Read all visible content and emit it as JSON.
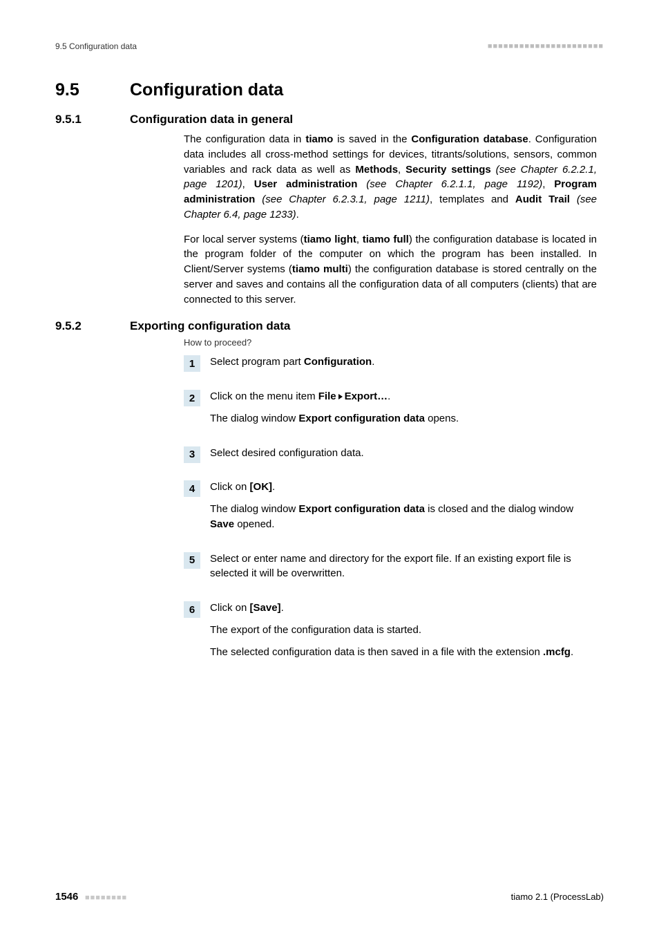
{
  "header": {
    "left": "9.5 Configuration data",
    "right_decor": "■■■■■■■■■■■■■■■■■■■■■■"
  },
  "section": {
    "number": "9.5",
    "title": "Configuration data"
  },
  "sub1": {
    "number": "9.5.1",
    "title": "Configuration data in general",
    "p1_a": "The configuration data in ",
    "p1_b": "tiamo",
    "p1_c": " is saved in the ",
    "p1_d": "Configuration database",
    "p1_e": ". Configuration data includes all cross-method settings for devices, titrants/solutions, sensors, common variables and rack data as well as ",
    "p1_f": "Methods",
    "p1_g": ", ",
    "p1_h": "Security settings",
    "p1_i": " (see Chapter 6.2.2.1, page 1201)",
    "p1_j": ", ",
    "p1_k": "User administration",
    "p1_l": " (see Chapter 6.2.1.1, page 1192)",
    "p1_m": ", ",
    "p1_n": "Program administration",
    "p1_o": " (see Chapter 6.2.3.1, page 1211)",
    "p1_p": ", templates and ",
    "p1_q": "Audit Trail",
    "p1_r": " (see Chapter 6.4, page 1233)",
    "p1_s": ".",
    "p2_a": "For local server systems (",
    "p2_b": "tiamo light",
    "p2_c": ", ",
    "p2_d": "tiamo full",
    "p2_e": ") the configuration database is located in the program folder of the computer on which the program has been installed. In Client/Server systems (",
    "p2_f": "tiamo multi",
    "p2_g": ") the configuration database is stored centrally on the server and saves and contains all the configuration data of all computers (clients) that are connected to this server."
  },
  "sub2": {
    "number": "9.5.2",
    "title": "Exporting configuration data",
    "howto": "How to proceed?",
    "steps": [
      {
        "n": "1",
        "lines": [
          {
            "parts": [
              {
                "t": "Select program part "
              },
              {
                "t": "Configuration",
                "b": true
              },
              {
                "t": "."
              }
            ]
          }
        ]
      },
      {
        "n": "2",
        "lines": [
          {
            "parts": [
              {
                "t": "Click on the menu item "
              },
              {
                "t": "File",
                "b": true
              },
              {
                "tri": true
              },
              {
                "t": "Export…",
                "b": true
              },
              {
                "t": "."
              }
            ]
          },
          {
            "parts": [
              {
                "t": "The dialog window "
              },
              {
                "t": "Export configuration data",
                "b": true
              },
              {
                "t": " opens."
              }
            ]
          }
        ]
      },
      {
        "n": "3",
        "lines": [
          {
            "parts": [
              {
                "t": "Select desired configuration data."
              }
            ]
          }
        ]
      },
      {
        "n": "4",
        "lines": [
          {
            "parts": [
              {
                "t": "Click on "
              },
              {
                "t": "[OK]",
                "b": true
              },
              {
                "t": "."
              }
            ]
          },
          {
            "parts": [
              {
                "t": "The dialog window "
              },
              {
                "t": "Export configuration data",
                "b": true
              },
              {
                "t": " is closed and the dialog window "
              },
              {
                "t": "Save",
                "b": true
              },
              {
                "t": " opened."
              }
            ]
          }
        ]
      },
      {
        "n": "5",
        "lines": [
          {
            "parts": [
              {
                "t": "Select or enter name and directory for the export file. If an existing export file is selected it will be overwritten."
              }
            ]
          }
        ]
      },
      {
        "n": "6",
        "lines": [
          {
            "parts": [
              {
                "t": "Click on "
              },
              {
                "t": "[Save]",
                "b": true
              },
              {
                "t": "."
              }
            ]
          },
          {
            "parts": [
              {
                "t": "The export of the configuration data is started."
              }
            ]
          },
          {
            "parts": [
              {
                "t": "The selected configuration data is then saved in a file with the extension "
              },
              {
                "t": ".mcfg",
                "b": true
              },
              {
                "t": "."
              }
            ]
          }
        ]
      }
    ]
  },
  "footer": {
    "page": "1546",
    "decor": "■■■■■■■■",
    "right": "tiamo 2.1 (ProcessLab)"
  }
}
